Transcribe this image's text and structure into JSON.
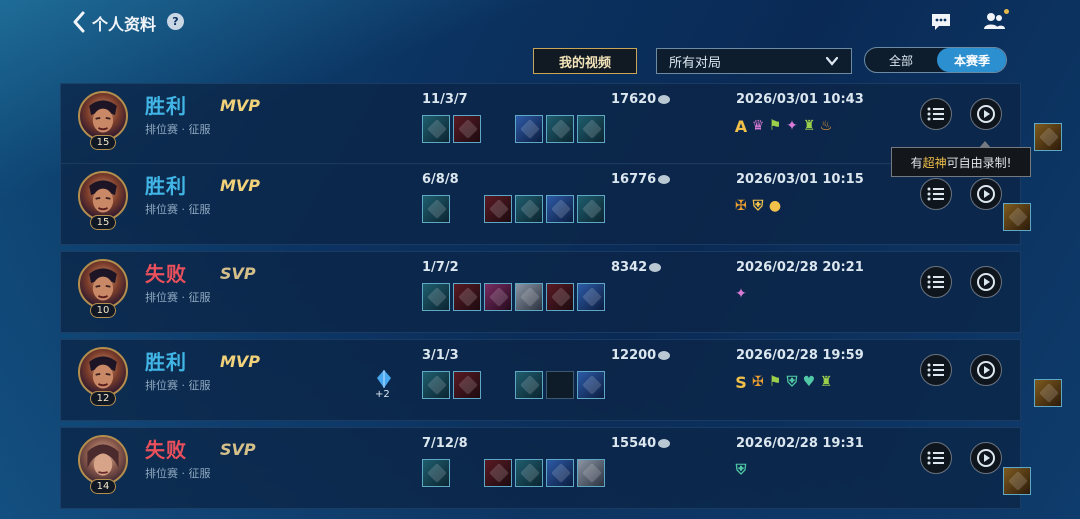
{
  "header": {
    "back_icon": "chevron-left-icon",
    "title": "个人资料",
    "help": "?",
    "chat_icon": "chat-bubble-icon",
    "friends_icon": "friends-icon"
  },
  "filters": {
    "video_button": "我的视频",
    "match_filter": "所有对局",
    "segment": {
      "all": "全部",
      "season": "本赛季",
      "selected": "本赛季"
    }
  },
  "tooltip": {
    "prefix": "有",
    "highlight": "超神",
    "suffix": "可自由录制!"
  },
  "colors": {
    "win": "#41b6e6",
    "loss": "#e8505b",
    "accent": "#2b8fd0",
    "gold": "#f0c04a"
  },
  "matches": [
    {
      "level": "15",
      "result": "胜利",
      "outcome": "win",
      "mode": "排位赛 · 征服",
      "badge": "MVP",
      "kda": "11/3/7",
      "gold": "17620",
      "date": "2026/03/01 10:43",
      "tags": [
        "A"
      ]
    },
    {
      "level": "15",
      "result": "胜利",
      "outcome": "win",
      "mode": "排位赛 · 征服",
      "badge": "MVP",
      "kda": "6/8/8",
      "gold": "16776",
      "date": "2026/03/01 10:15",
      "tags": []
    },
    {
      "level": "10",
      "result": "失败",
      "outcome": "loss",
      "mode": "排位赛 · 征服",
      "badge": "SVP",
      "kda": "1/7/2",
      "gold": "8342",
      "date": "2026/02/28 20:21",
      "tags": []
    },
    {
      "level": "12",
      "result": "胜利",
      "outcome": "win",
      "mode": "排位赛 · 征服",
      "badge": "MVP",
      "kda": "3/1/3",
      "gold": "12200",
      "date": "2026/02/28 19:59",
      "tags": [
        "S"
      ],
      "extra": "+2"
    },
    {
      "level": "14",
      "result": "失败",
      "outcome": "loss",
      "mode": "排位赛 · 征服",
      "badge": "SVP",
      "kda": "7/12/8",
      "gold": "15540",
      "date": "2026/02/28 19:31",
      "tags": []
    }
  ]
}
